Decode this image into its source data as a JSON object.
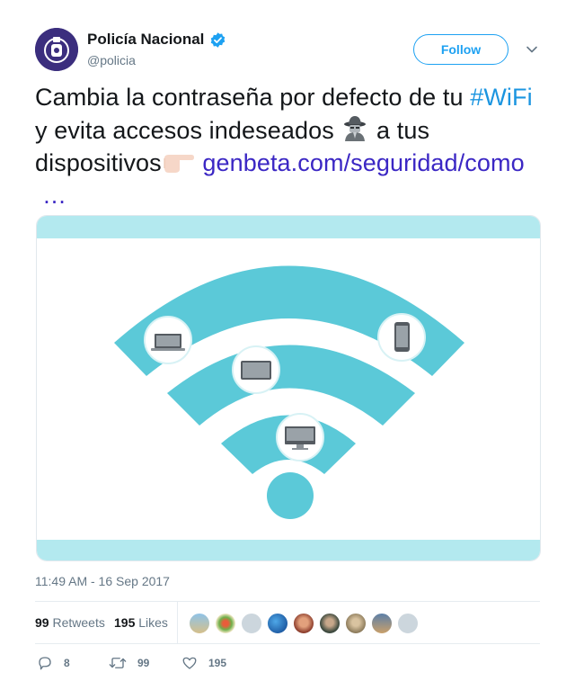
{
  "account": {
    "display_name": "Policía Nacional",
    "handle": "@policia",
    "verified": true,
    "follow_label": "Follow"
  },
  "tweet": {
    "text_part1": "Cambia la contraseña por defecto de tu ",
    "hashtag": "#WiFi",
    "text_part2": " y evita accesos indeseados ",
    "text_part3": " a tus dispositivos",
    "link": "genbeta.com/seguridad/como",
    "ellipsis": "…",
    "emoji_1": "detective-icon",
    "emoji_2": "pointing-hand-icon"
  },
  "media": {
    "description_icons": [
      "wifi-icon",
      "laptop-icon",
      "tablet-icon",
      "phone-icon",
      "monitor-icon"
    ],
    "colors": {
      "background": "#b3e9ef",
      "arc": "#5bc9d8"
    }
  },
  "timestamp": "11:49 AM - 16 Sep 2017",
  "stats": {
    "retweets_count": "99",
    "retweets_label": "Retweets",
    "likes_count": "195",
    "likes_label": "Likes"
  },
  "actions": {
    "reply_count": "8",
    "retweet_count": "99",
    "like_count": "195"
  },
  "colors": {
    "accent": "#1da1f2",
    "hashtag": "#1b95e0",
    "link": "#3b27c4",
    "muted": "#657786",
    "text": "#14171a"
  }
}
